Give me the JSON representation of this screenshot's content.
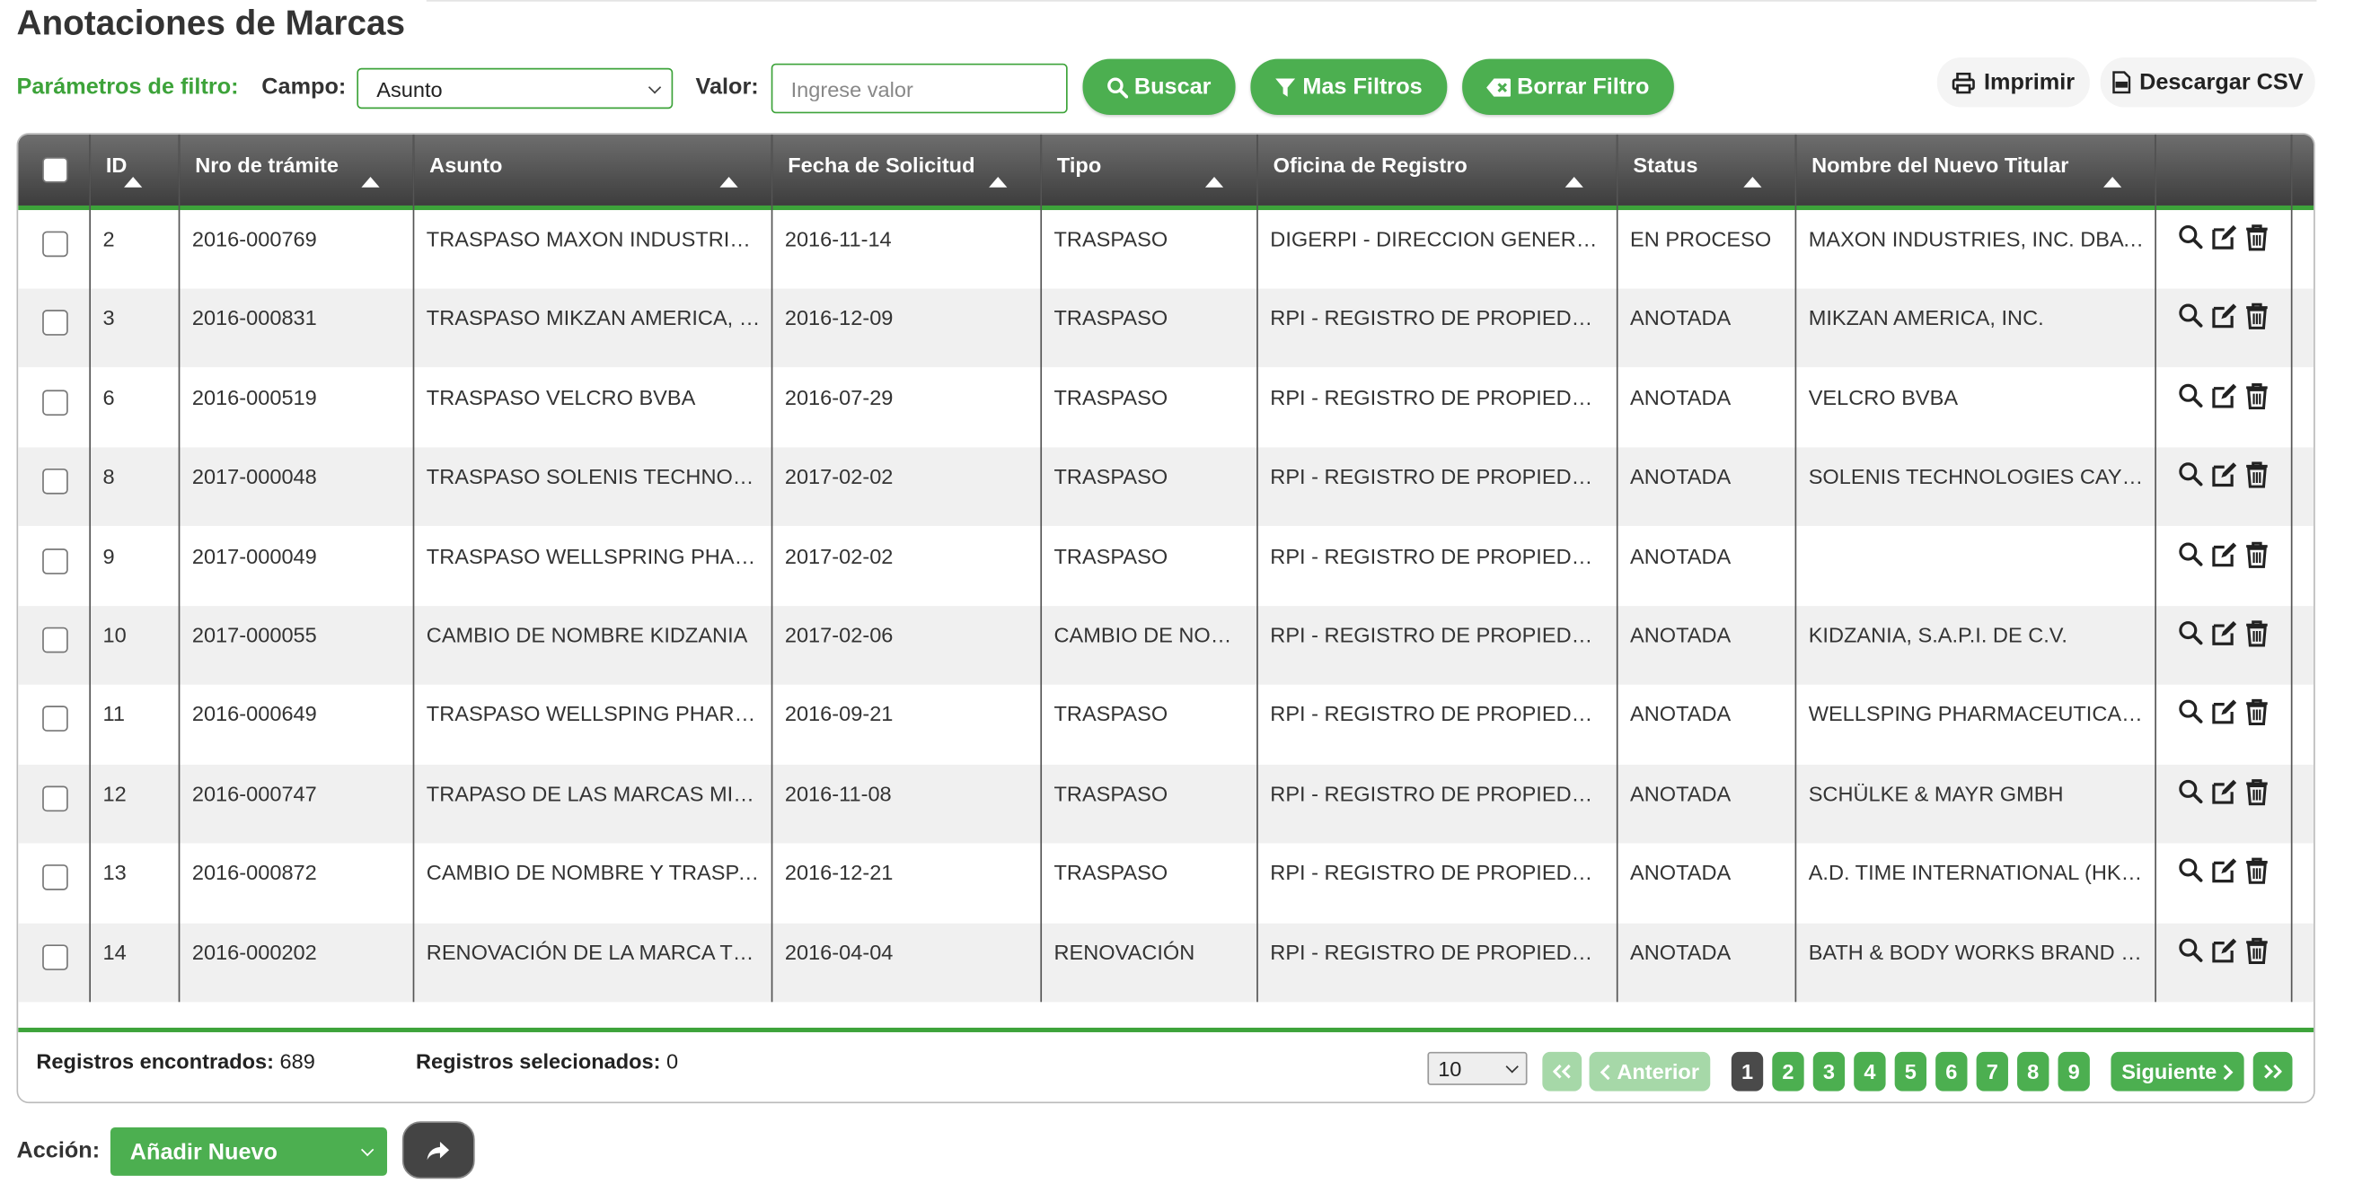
{
  "page": {
    "title": "Anotaciones de Marcas"
  },
  "filter": {
    "params_label": "Parámetros de filtro:",
    "campo_label": "Campo:",
    "campo_value": "Asunto",
    "valor_label": "Valor:",
    "valor_placeholder": "Ingrese valor",
    "buscar": "Buscar",
    "mas_filtros": "Mas Filtros",
    "borrar_filtro": "Borrar Filtro"
  },
  "toolbar": {
    "imprimir": "Imprimir",
    "descargar_csv": "Descargar CSV"
  },
  "table": {
    "columns": [
      "ID",
      "Nro de trámite",
      "Asunto",
      "Fecha de Solicitud",
      "Tipo",
      "Oficina de Registro",
      "Status",
      "Nombre del Nuevo Titular"
    ],
    "rows": [
      {
        "id": "2",
        "nro": "2016-000769",
        "asunto": "TRASPASO MAXON INDUSTRIES, INC. DBA",
        "fecha": "2016-11-14",
        "tipo": "TRASPASO",
        "oficina": "DIGERPI - DIRECCION GENERAL DEL REGISTRO",
        "status": "EN PROCESO",
        "titular": "MAXON INDUSTRIES, INC. DBA MAXON"
      },
      {
        "id": "3",
        "nro": "2016-000831",
        "asunto": "TRASPASO MIKZAN AMERICA, INC.",
        "fecha": "2016-12-09",
        "tipo": "TRASPASO",
        "oficina": "RPI - REGISTRO DE PROPIEDAD INDUSTRIAL",
        "status": "ANOTADA",
        "titular": "MIKZAN AMERICA, INC."
      },
      {
        "id": "6",
        "nro": "2016-000519",
        "asunto": "TRASPASO VELCRO BVBA",
        "fecha": "2016-07-29",
        "tipo": "TRASPASO",
        "oficina": "RPI - REGISTRO DE PROPIEDAD INDUSTRIAL",
        "status": "ANOTADA",
        "titular": "VELCRO BVBA"
      },
      {
        "id": "8",
        "nro": "2017-000048",
        "asunto": "TRASPASO SOLENIS TECHNOLOGIES",
        "fecha": "2017-02-02",
        "tipo": "TRASPASO",
        "oficina": "RPI - REGISTRO DE PROPIEDAD INDUSTRIAL",
        "status": "ANOTADA",
        "titular": "SOLENIS TECHNOLOGIES CAYMAN"
      },
      {
        "id": "9",
        "nro": "2017-000049",
        "asunto": "TRASPASO WELLSPRING PHARMACEUTICAL",
        "fecha": "2017-02-02",
        "tipo": "TRASPASO",
        "oficina": "RPI - REGISTRO DE PROPIEDAD INDUSTRIAL",
        "status": "ANOTADA",
        "titular": ""
      },
      {
        "id": "10",
        "nro": "2017-000055",
        "asunto": "CAMBIO DE NOMBRE KIDZANIA",
        "fecha": "2017-02-06",
        "tipo": "CAMBIO DE NOMBRE",
        "oficina": "RPI - REGISTRO DE PROPIEDAD INDUSTRIAL",
        "status": "ANOTADA",
        "titular": "KIDZANIA, S.A.P.I. DE C.V."
      },
      {
        "id": "11",
        "nro": "2016-000649",
        "asunto": "TRASPASO WELLSPING PHARMACEUTICAL",
        "fecha": "2016-09-21",
        "tipo": "TRASPASO",
        "oficina": "RPI - REGISTRO DE PROPIEDAD INDUSTRIAL",
        "status": "ANOTADA",
        "titular": "WELLSPING PHARMACEUTICAL CORPORATION"
      },
      {
        "id": "12",
        "nro": "2016-000747",
        "asunto": "TRAPASO DE LAS MARCAS MIKZAN",
        "fecha": "2016-11-08",
        "tipo": "TRASPASO",
        "oficina": "RPI - REGISTRO DE PROPIEDAD INDUSTRIAL",
        "status": "ANOTADA",
        "titular": "SCHÜLKE & MAYR GMBH"
      },
      {
        "id": "13",
        "nro": "2016-000872",
        "asunto": "CAMBIO DE NOMBRE Y TRASPASO",
        "fecha": "2016-12-21",
        "tipo": "TRASPASO",
        "oficina": "RPI - REGISTRO DE PROPIEDAD INDUSTRIAL",
        "status": "ANOTADA",
        "titular": "A.D. TIME INTERNATIONAL (HK) LIMITED"
      },
      {
        "id": "14",
        "nro": "2016-000202",
        "asunto": "RENOVACIÓN DE LA MARCA TEXTURES",
        "fecha": "2016-04-04",
        "tipo": "RENOVACIÓN",
        "oficina": "RPI - REGISTRO DE PROPIEDAD INDUSTRIAL",
        "status": "ANOTADA",
        "titular": "BATH & BODY WORKS BRAND MANAGEMENT"
      }
    ]
  },
  "footer": {
    "encontrados_label": "Registros encontrados:",
    "encontrados_value": "689",
    "seleccionados_label": "Registros selecionados:",
    "seleccionados_value": "0",
    "page_size": "10",
    "anterior": "Anterior",
    "siguiente": "Siguiente",
    "pages": [
      "1",
      "2",
      "3",
      "4",
      "5",
      "6",
      "7",
      "8",
      "9"
    ],
    "current_page": "1"
  },
  "action": {
    "label": "Acción:",
    "value": "Añadir Nuevo"
  },
  "icons": [
    "search-icon",
    "filter-icon",
    "eraser-icon",
    "print-icon",
    "csv-file-icon",
    "view-icon",
    "edit-icon",
    "delete-icon",
    "first-page-icon",
    "last-page-icon",
    "share-icon"
  ],
  "colors": {
    "accent": "#4caf50",
    "header_dark": "#3d3d3d",
    "current_page": "#4a4a4a"
  }
}
